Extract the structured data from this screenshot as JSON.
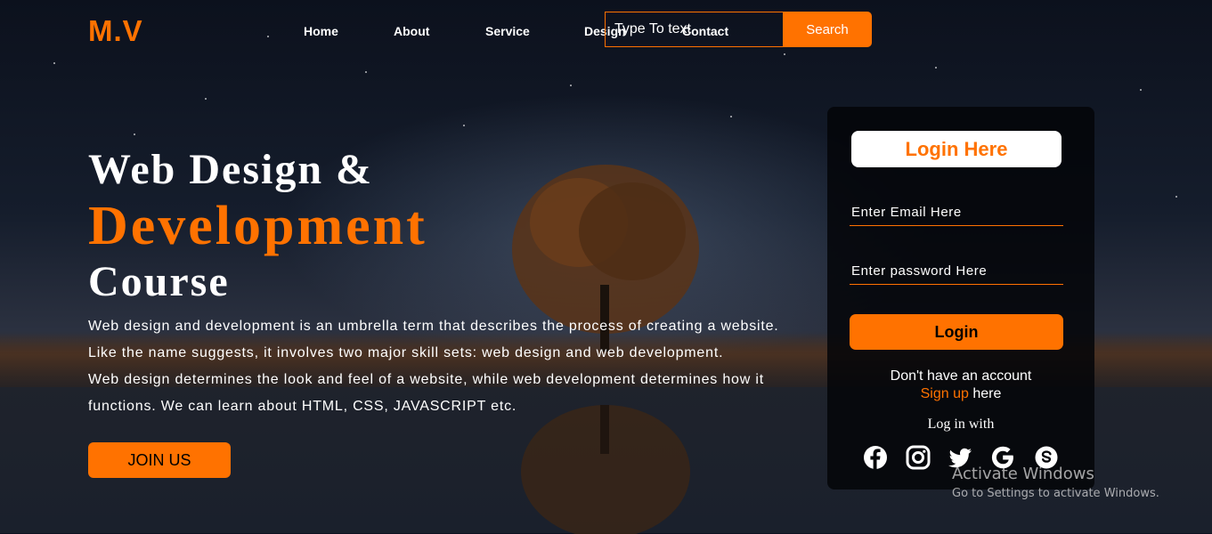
{
  "brand": {
    "logo": "M.V",
    "accent": "#ff7200"
  },
  "nav": {
    "items": [
      {
        "label": "Home"
      },
      {
        "label": "About"
      },
      {
        "label": "Service"
      },
      {
        "label": "Design"
      },
      {
        "label": "Contact"
      }
    ]
  },
  "search": {
    "placeholder": "Type To text",
    "button_label": "Search"
  },
  "hero": {
    "line1": "Web Design &",
    "line2": "Development",
    "line3": "Course",
    "paragraph_lines": [
      "Web design and development is an umbrella term that describes the process of creating a website.",
      "Like the name suggests, it involves two major skill sets: web design and web development.",
      "Web design determines the look and feel of a website, while web development determines how it",
      "functions. We can learn about HTML, CSS, JAVASCRIPT etc."
    ],
    "join_label": "JOIN US"
  },
  "login": {
    "title": "Login Here",
    "email_placeholder": "Enter Email Here",
    "password_placeholder": "Enter password Here",
    "button_label": "Login",
    "no_account": "Don't have an account",
    "signup_link": "Sign up",
    "signup_suffix": " here",
    "login_with": "Log in with",
    "social_icons": [
      "facebook-icon",
      "instagram-icon",
      "twitter-icon",
      "google-icon",
      "skype-icon"
    ]
  },
  "watermark": {
    "title": "Activate Windows",
    "subtitle": "Go to Settings to activate Windows."
  }
}
